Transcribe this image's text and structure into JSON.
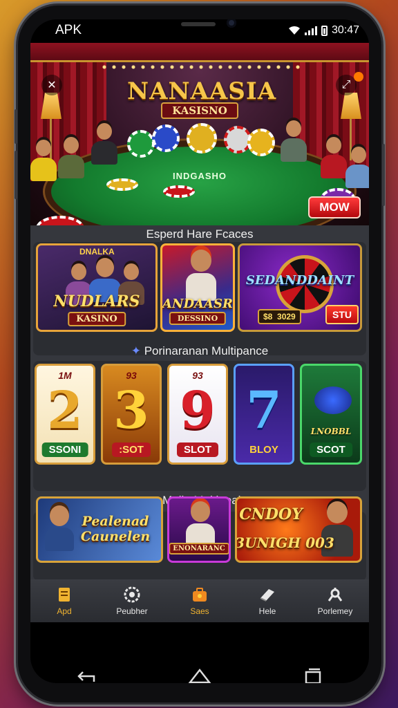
{
  "status_bar": {
    "carrier": "APK",
    "time": "30:47"
  },
  "hero": {
    "logo_title": "NANAASIA",
    "logo_subtitle": "KASISNO",
    "table_text": "INDGASHO",
    "cta_label": "MOW"
  },
  "sections": [
    {
      "title": "Esperd Hare Fcaces"
    },
    {
      "title": "Porinaranan Multipance"
    },
    {
      "title": "Malle Multipeain"
    }
  ],
  "featured": [
    {
      "title": "NUDLARS",
      "subtitle": "KASINO",
      "badge": "DNALKA"
    },
    {
      "title": "ANDAASR",
      "subtitle": "DESSINO"
    },
    {
      "title": "SEDANDDAINT",
      "amount": "$8  3029",
      "button": "STU"
    }
  ],
  "slots": [
    {
      "top": "1M",
      "number": "2",
      "label": "SSONI",
      "color": "#e8a82d"
    },
    {
      "top": "93",
      "number": "3",
      "label": ":SOT",
      "color": "#e07a10"
    },
    {
      "top": "93",
      "number": "9",
      "label": "SLOT",
      "color": "#d8202a"
    },
    {
      "top": "",
      "number": "7",
      "label": "BLOY",
      "color": "#5a2bb0"
    },
    {
      "top": "",
      "number": "",
      "label": "SCOT",
      "card_text": "LNOBBL",
      "color": "#1e8a3a"
    }
  ],
  "bottom_cards": [
    {
      "title": "Pealenad Caunelen"
    },
    {
      "title": "ENONARANC"
    },
    {
      "title": "CNDOY",
      "subtitle": "3UNIGH 003"
    }
  ],
  "bottom_nav": [
    {
      "label": "Apd",
      "icon": "document-icon"
    },
    {
      "label": "Peubher",
      "icon": "gear-icon"
    },
    {
      "label": "Saes",
      "icon": "briefcase-icon"
    },
    {
      "label": "Hele",
      "icon": "cards-icon"
    },
    {
      "label": "Porlemey",
      "icon": "profile-icon"
    }
  ],
  "colors": {
    "accent": "#e7a43a",
    "cta": "#d81a1f",
    "nav_active": "#f0b330"
  }
}
